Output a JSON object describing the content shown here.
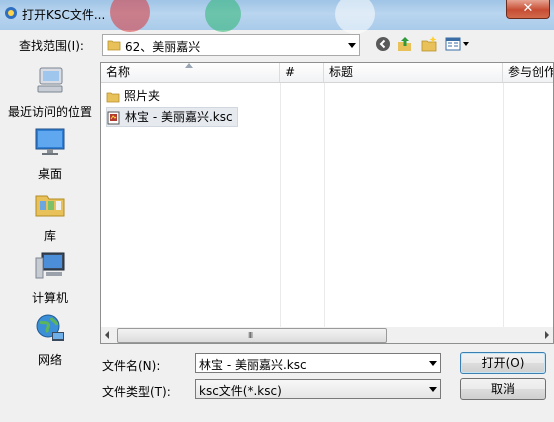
{
  "window": {
    "title": "打开KSC文件..."
  },
  "lookin": {
    "label": "查找范围(I):",
    "value": "62、美丽嘉兴"
  },
  "toolbar": {
    "icons": [
      "back-icon",
      "up-folder-icon",
      "new-folder-icon",
      "view-menu-icon"
    ]
  },
  "places": [
    {
      "label": "最近访问的位置",
      "icon": "recent-places-icon"
    },
    {
      "label": "桌面",
      "icon": "desktop-icon"
    },
    {
      "label": "库",
      "icon": "libraries-icon"
    },
    {
      "label": "计算机",
      "icon": "computer-icon"
    },
    {
      "label": "网络",
      "icon": "network-icon"
    }
  ],
  "list": {
    "columns": [
      "名称",
      "#",
      "标题",
      "参与创作"
    ],
    "rows": [
      {
        "name": "照片夹",
        "icon": "folder-icon"
      },
      {
        "name": "林宝 - 美丽嘉兴.ksc",
        "icon": "ksc-file-icon"
      }
    ],
    "scroll_grip": "III"
  },
  "filename": {
    "label": "文件名(N):",
    "value": "林宝 - 美丽嘉兴.ksc"
  },
  "filetype": {
    "label": "文件类型(T):",
    "value": "ksc文件(*.ksc)"
  },
  "buttons": {
    "open": "打开(O)",
    "cancel": "取消"
  },
  "colors": {
    "selection": "#e6e9ee",
    "titlebar": "#a9cbea",
    "close": "#c74d33"
  }
}
